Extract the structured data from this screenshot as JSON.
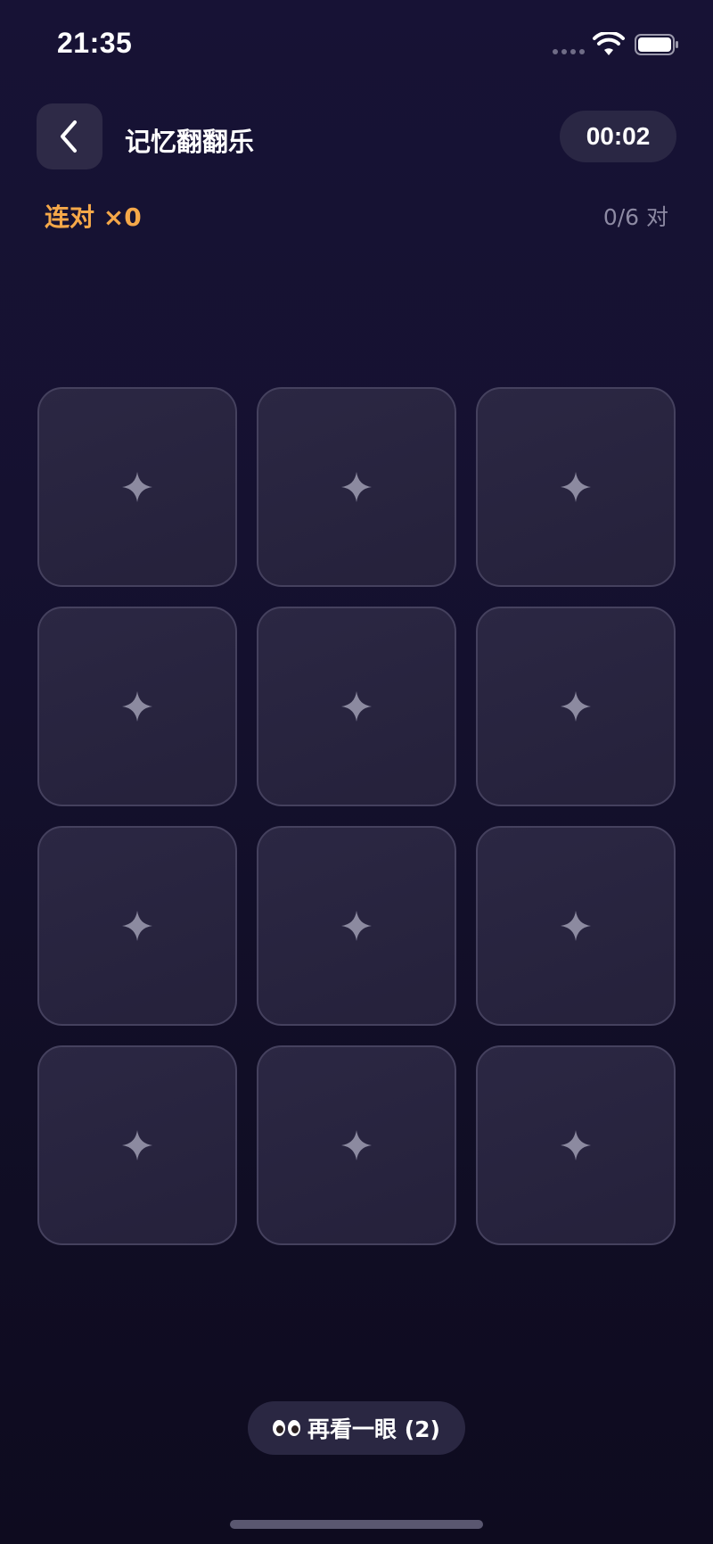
{
  "status_bar": {
    "time": "21:35"
  },
  "header": {
    "title": "记忆翻翻乐",
    "timer": "00:02"
  },
  "stats": {
    "combo": "连对 ×0",
    "pairs": "0/6 对"
  },
  "board": {
    "rows": 4,
    "columns": 3,
    "card_icon": "sparkle-icon",
    "cards": [
      "",
      "",
      "",
      "",
      "",
      "",
      "",
      "",
      "",
      "",
      "",
      ""
    ]
  },
  "peek": {
    "icon": "eyes-icon",
    "label": "再看一眼 (2)"
  },
  "colors": {
    "background": "#151130",
    "accent_combo": "#f5a849",
    "card_border": "#45415e",
    "card_fill": "#28243f",
    "sparkle": "#8c8aa0"
  }
}
